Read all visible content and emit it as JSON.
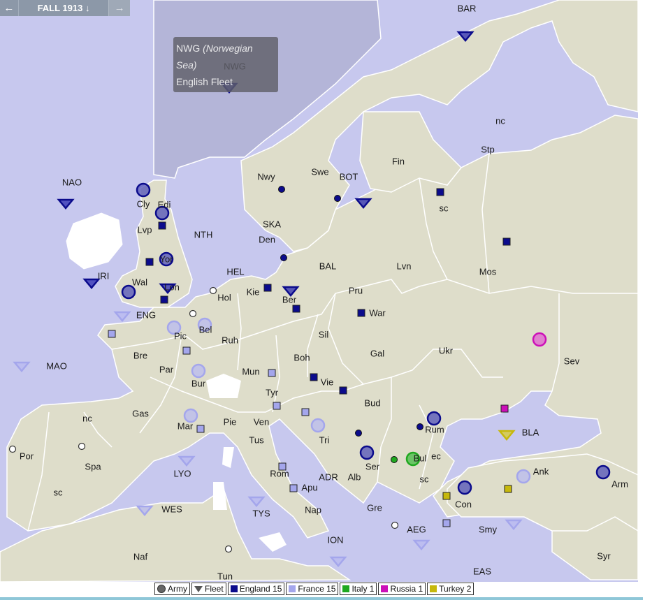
{
  "phase": {
    "label": "FALL 1913",
    "arrow": "↓",
    "prev_icon": "←",
    "next_icon": "→"
  },
  "tooltip": {
    "code": "NWG",
    "name": "(Norwegian Sea)",
    "unit": "English Fleet"
  },
  "colors": {
    "sea": "#c7c8ee",
    "land": "#deddca",
    "border": "#ffffff",
    "england": "#0b0b8c",
    "france": "#a4a6ec",
    "italy": "#1fa81f",
    "russia": "#cc10b8",
    "turkey": "#c6b80c",
    "neutral": "#ffffff"
  },
  "legend": {
    "army": "Army",
    "fleet": "Fleet",
    "england": "England 15",
    "france": "France 15",
    "italy": "Italy 1",
    "russia": "Russia 1",
    "turkey": "Turkey 2"
  },
  "provinces": [
    "BAR",
    "NWG",
    "nc",
    "Stp",
    "Fin",
    "NAO",
    "Swe",
    "BOT",
    "Nwy",
    "Cly",
    "Edi",
    "sc",
    "SKA",
    "Lvp",
    "NTH",
    "Den",
    "Yor",
    "IRI",
    "HEL",
    "BAL",
    "Lvn",
    "Mos",
    "Wal",
    "Lon",
    "Kie",
    "Pru",
    "Hol",
    "Ber",
    "ENG",
    "Bel",
    "War",
    "Pic",
    "Ruh",
    "Sil",
    "Bre",
    "Gal",
    "Ukr",
    "Sev",
    "MAO",
    "Par",
    "Boh",
    "Mun",
    "Vie",
    "Bur",
    "Tyr",
    "Bud",
    "Gas",
    "nc",
    "Mar",
    "Pie",
    "Ven",
    "Tri",
    "Rum",
    "BLA",
    "Tus",
    "Por",
    "Spa",
    "LYO",
    "Rom",
    "ADR",
    "Alb",
    "Ser",
    "Bul",
    "ec",
    "sc",
    "Ank",
    "Arm",
    "sc",
    "Apu",
    "Con",
    "WES",
    "TYS",
    "Nap",
    "Gre",
    "AEG",
    "Smy",
    "ION",
    "Naf",
    "EAS",
    "Syr",
    "Tun"
  ]
}
